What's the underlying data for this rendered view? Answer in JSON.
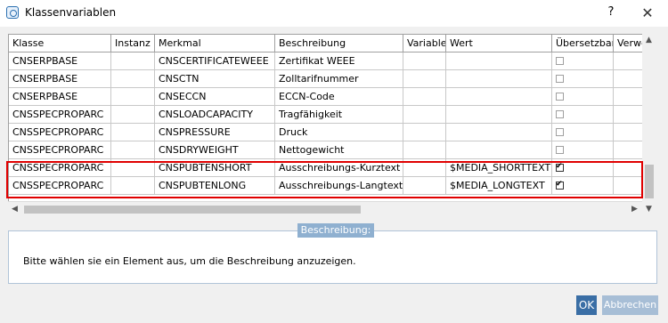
{
  "window": {
    "title": "Klassenvariablen",
    "help": "?",
    "close": "✕"
  },
  "columns": [
    "Klasse",
    "Instanz",
    "Merkmal",
    "Beschreibung",
    "Variable",
    "Wert",
    "Übersetzbar",
    "Verwe"
  ],
  "rows": [
    {
      "klasse": "CNSERPBASE",
      "instanz": "",
      "merkmal": "CNSCERTIFICATEWEEE",
      "beschreibung": "Zertifikat WEEE",
      "variable": "",
      "wert": "",
      "uebersetzbar": false
    },
    {
      "klasse": "CNSERPBASE",
      "instanz": "",
      "merkmal": "CNSCTN",
      "beschreibung": "Zolltarifnummer",
      "variable": "",
      "wert": "",
      "uebersetzbar": false
    },
    {
      "klasse": "CNSERPBASE",
      "instanz": "",
      "merkmal": "CNSECCN",
      "beschreibung": "ECCN-Code",
      "variable": "",
      "wert": "",
      "uebersetzbar": false
    },
    {
      "klasse": "CNSSPECPROPARC",
      "instanz": "",
      "merkmal": "CNSLOADCAPACITY",
      "beschreibung": "Tragfähigkeit",
      "variable": "",
      "wert": "",
      "uebersetzbar": false
    },
    {
      "klasse": "CNSSPECPROPARC",
      "instanz": "",
      "merkmal": "CNSPRESSURE",
      "beschreibung": "Druck",
      "variable": "",
      "wert": "",
      "uebersetzbar": false
    },
    {
      "klasse": "CNSSPECPROPARC",
      "instanz": "",
      "merkmal": "CNSDRYWEIGHT",
      "beschreibung": "Nettogewicht",
      "variable": "",
      "wert": "",
      "uebersetzbar": false
    },
    {
      "klasse": "CNSSPECPROPARC",
      "instanz": "",
      "merkmal": "CNSPUBTENSHORT",
      "beschreibung": "Ausschreibungs-Kurztext",
      "variable": "",
      "wert": "$MEDIA_SHORTTEXT",
      "uebersetzbar": true
    },
    {
      "klasse": "CNSSPECPROPARC",
      "instanz": "",
      "merkmal": "CNSPUBTENLONG",
      "beschreibung": "Ausschreibungs-Langtext",
      "variable": "",
      "wert": "$MEDIA_LONGTEXT",
      "uebersetzbar": true
    }
  ],
  "description": {
    "label": "Beschreibung:",
    "text": "Bitte wählen sie ein Element aus, um die Beschreibung anzuzeigen."
  },
  "buttons": {
    "ok": "OK",
    "cancel": "Abbrechen"
  },
  "colors": {
    "highlight": "#e00000",
    "ok_bg": "#3a6ea5",
    "cancel_bg": "#a7bed6",
    "desc_label_bg": "#8fb0d0"
  }
}
